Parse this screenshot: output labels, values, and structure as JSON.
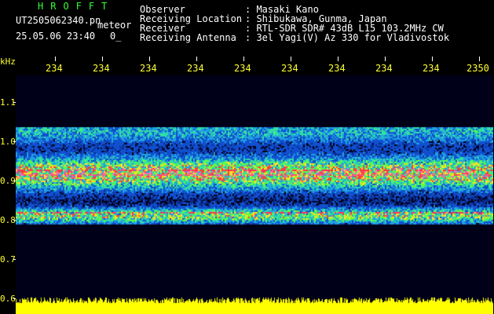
{
  "header": {
    "app_title": "HROFFT",
    "file_name": "UT2505062340.pn",
    "file_suffix": "meteor",
    "timestamp": "25.05.06 23:40",
    "count": "0_",
    "fields": [
      {
        "label": "Observer",
        "value": ": Masaki Kano"
      },
      {
        "label": "Receiving Location",
        "value": ": Shibukawa, Gunma, Japan"
      },
      {
        "label": "Receiver",
        "value": ": RTL-SDR SDR# 43dB L15 103.2MHz CW"
      },
      {
        "label": "Receiving Antenna",
        "value": ": 3el Yagi(V) Az 330 for Vladivostok"
      }
    ]
  },
  "axes": {
    "unit": "kHz",
    "time_labels": [
      "234",
      "234",
      "234",
      "234",
      "234",
      "234",
      "234",
      "234",
      "234",
      "2350"
    ],
    "freq_labels": [
      "1.1",
      "1.0",
      "0.9",
      "0.8",
      "0.7",
      "0.6"
    ]
  },
  "colors": {
    "background": "#000000",
    "label_text": "#ffffff",
    "title_text": "#33ff33",
    "axis_text": "#ffff33",
    "noise_bar": "#ffff00"
  }
}
